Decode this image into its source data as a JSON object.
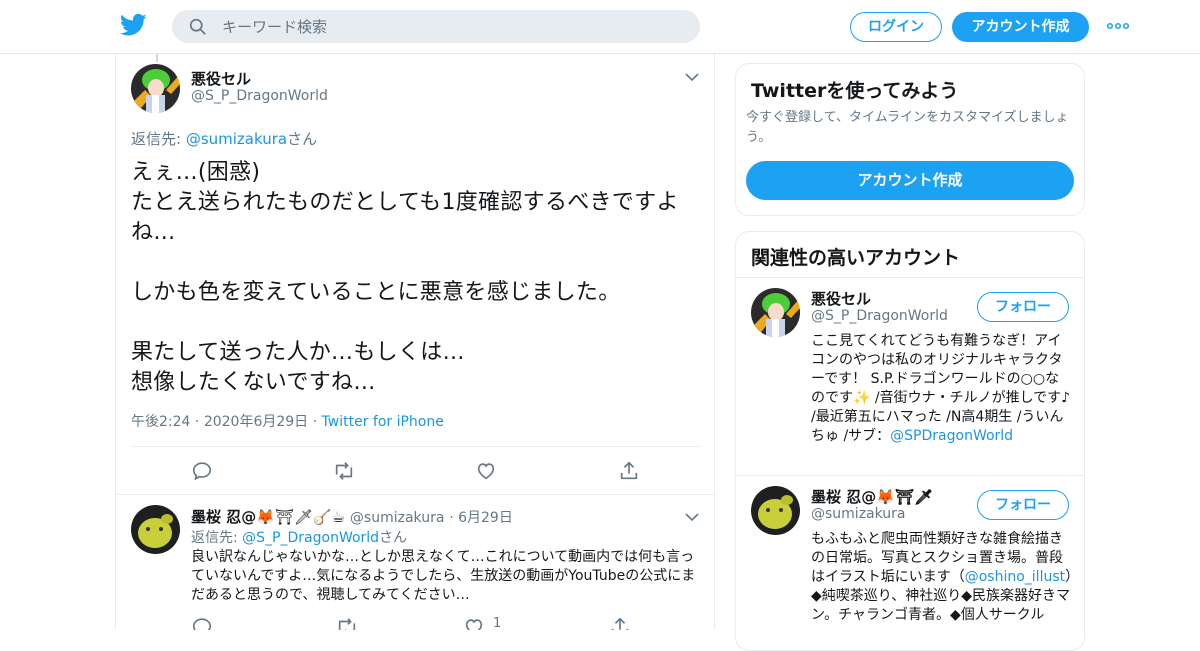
{
  "topbar": {
    "search_placeholder": "キーワード検索",
    "login_label": "ログイン",
    "signup_label": "アカウント作成"
  },
  "tweet": {
    "name": "悪役セル",
    "handle": "@S_P_DragonWorld",
    "reply_prefix": "返信先: ",
    "reply_to": "@sumizakura",
    "reply_suffix": "さん",
    "text": "えぇ…(困惑)\nたとえ送られたものだとしても1度確認するべきですよね…\n\nしかも色を変えていることに悪意を感じました。\n\n果たして送った人か…もしくは…\n想像したくないですね…",
    "time": "午後2:24",
    "date": "2020年6月29日",
    "via": "Twitter for iPhone"
  },
  "reply": {
    "name": "墨桜 忍@",
    "name_emoji": "🦊⛩🗡🪕☕",
    "handle": "@sumizakura",
    "date": "6月29日",
    "reply_prefix": "返信先: ",
    "reply_to": "@S_P_DragonWorld",
    "reply_suffix": "さん",
    "text": "良い訳なんじゃないかな…としか思えなくて…これについて動画内では何も言っていないんですよ…気になるようでしたら、生放送の動画がYouTubeの公式にまだあると思うので、視聴してみてください…",
    "like_count": "1"
  },
  "sidebar": {
    "try_title": "Twitterを使ってみよう",
    "try_desc": "今すぐ登録して、タイムラインをカスタマイズしましょう。",
    "try_button": "アカウント作成",
    "related_title": "関連性の高いアカウント",
    "accounts": [
      {
        "name": "悪役セル",
        "handle": "@S_P_DragonWorld",
        "follow": "フォロー",
        "bio_1": "ここ見てくれてどうも有難うなぎ！アイコンのやつは私のオリジナルキャラクターです！ S.P.ドラゴンワールドの○○なのです",
        "bio_emoji": "✨",
        "bio_2": " /音街ウナ・チルノが推しです♪ /最近第五にハマった /N高4期生 /ういんちゅ /サブ：",
        "bio_link": "@SPDragonWorld"
      },
      {
        "name": "墨桜 忍@",
        "name_emoji": "🦊⛩🗡",
        "handle": "@sumizakura",
        "follow": "フォロー",
        "bio_1": "もふもふと爬虫両性類好きな雑食絵描きの日常垢。写真とスクショ置き場。普段はイラスト垢にいます（",
        "bio_link": "@oshino_illust",
        "bio_2": "）◆純喫茶巡り、神社巡り◆民族楽器好きマン。チャランゴ青者。◆個人サークル"
      }
    ]
  },
  "colors": {
    "accent": "#1da1f2",
    "link": "#1b95e0",
    "muted": "#657786",
    "border": "#e6ecf0"
  }
}
